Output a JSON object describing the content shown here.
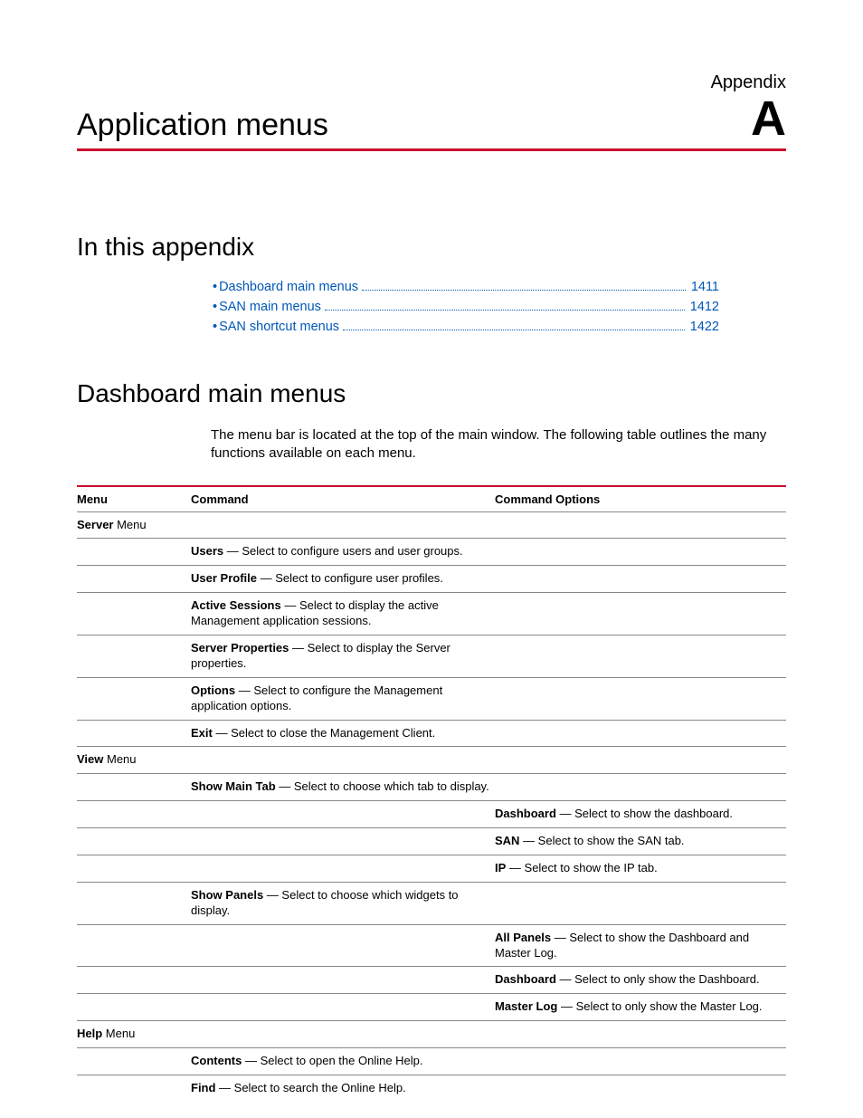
{
  "header": {
    "appendix_label": "Appendix",
    "title": "Application menus",
    "appendix_letter": "A"
  },
  "sections": {
    "in_this_appendix": "In this appendix",
    "dashboard_main_menus": "Dashboard main menus"
  },
  "toc": [
    {
      "label": "Dashboard main menus",
      "page": "1411"
    },
    {
      "label": "SAN main menus",
      "page": "1412"
    },
    {
      "label": "SAN shortcut menus",
      "page": "1422"
    }
  ],
  "intro": "The menu bar is located at the top of the main window. The following table outlines the many functions available on each menu.",
  "table": {
    "headers": {
      "menu": "Menu",
      "command": "Command",
      "options": "Command Options"
    },
    "rows": [
      {
        "menu_bold": "Server",
        "menu_rest": " Menu",
        "command": "",
        "options": ""
      },
      {
        "menu": "",
        "cmd_bold": "Users",
        "cmd_rest": " — Select to configure users and user groups.",
        "options": ""
      },
      {
        "menu": "",
        "cmd_bold": "User Profile",
        "cmd_rest": " — Select to configure user profiles.",
        "options": ""
      },
      {
        "menu": "",
        "cmd_bold": "Active Sessions",
        "cmd_rest": " — Select to display the active Management application sessions.",
        "options": ""
      },
      {
        "menu": "",
        "cmd_bold": "Server Properties",
        "cmd_rest": " — Select to display the Server properties.",
        "options": ""
      },
      {
        "menu": "",
        "cmd_bold": "Options",
        "cmd_rest": " — Select to configure the Management application options.",
        "options": ""
      },
      {
        "menu": "",
        "cmd_bold": "Exit",
        "cmd_rest": " — Select to close the Management Client.",
        "options": ""
      },
      {
        "menu_bold": "View",
        "menu_rest": " Menu",
        "command": "",
        "options": ""
      },
      {
        "menu": "",
        "cmd_bold": "Show Main Tab",
        "cmd_rest": " — Select to choose which tab to display.",
        "options": ""
      },
      {
        "menu": "",
        "command": "",
        "opt_bold": "Dashboard",
        "opt_rest": " — Select to show the dashboard."
      },
      {
        "menu": "",
        "command": "",
        "opt_bold": "SAN",
        "opt_rest": " — Select to show the SAN tab."
      },
      {
        "menu": "",
        "command": "",
        "opt_bold": "IP",
        "opt_rest": " — Select to show the IP tab."
      },
      {
        "menu": "",
        "cmd_bold": "Show Panels",
        "cmd_rest": " — Select to choose which widgets to display.",
        "options": ""
      },
      {
        "menu": "",
        "command": "",
        "opt_bold": "All Panels",
        "opt_rest": " — Select to show the Dashboard and Master Log."
      },
      {
        "menu": "",
        "command": "",
        "opt_bold": "Dashboard",
        "opt_rest": " — Select to only show the Dashboard."
      },
      {
        "menu": "",
        "command": "",
        "opt_bold": "Master Log",
        "opt_rest": " — Select to only show the Master Log."
      },
      {
        "menu_bold": "Help",
        "menu_rest": " Menu",
        "command": "",
        "options": ""
      },
      {
        "menu": "",
        "cmd_bold": "Contents",
        "cmd_rest": " — Select to open the Online Help.",
        "options": ""
      },
      {
        "menu": "",
        "cmd_bold": "Find",
        "cmd_rest": " — Select to search the Online Help.",
        "options": "",
        "no_bottom": true
      }
    ]
  }
}
